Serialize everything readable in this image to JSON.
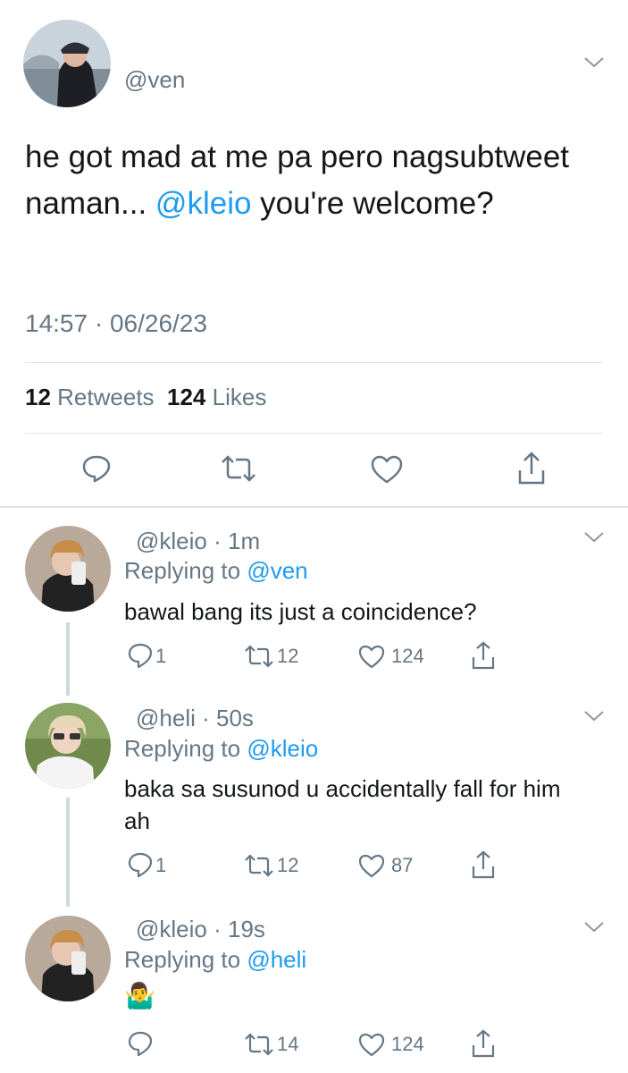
{
  "main_tweet": {
    "handle": "@ven",
    "text_before": "he got mad at me pa pero nagsubtweet naman... ",
    "mention": "@kleio",
    "text_after": " you're welcome?",
    "timestamp": "14:57 · 06/26/23",
    "retweets_count": "12",
    "retweets_label": "Retweets",
    "likes_count": "124",
    "likes_label": "Likes",
    "icons": [
      "reply-icon",
      "retweet-icon",
      "like-icon",
      "share-icon"
    ]
  },
  "replies": [
    {
      "handle": "@kleio",
      "time": "· 1m",
      "replying_prefix": "Replying to",
      "replying_to": "@ven",
      "text": "bawal bang its just a coincidence?",
      "reply_count": "1",
      "retweet_count": "12",
      "like_count": "124"
    },
    {
      "handle": "@heli",
      "time": "· 50s",
      "replying_prefix": "Replying to",
      "replying_to": "@kleio",
      "text": "baka sa susunod u accidentally fall for him ah",
      "reply_count": "1",
      "retweet_count": "12",
      "like_count": "87"
    },
    {
      "handle": "@kleio",
      "time": "· 19s",
      "replying_prefix": "Replying to",
      "replying_to": "@heli",
      "text": "🤷‍♂️",
      "reply_count": "",
      "retweet_count": "14",
      "like_count": "124"
    }
  ],
  "colors": {
    "accent": "#1d9bf0",
    "secondary_text": "#657786",
    "divider": "#dfe3e6"
  }
}
